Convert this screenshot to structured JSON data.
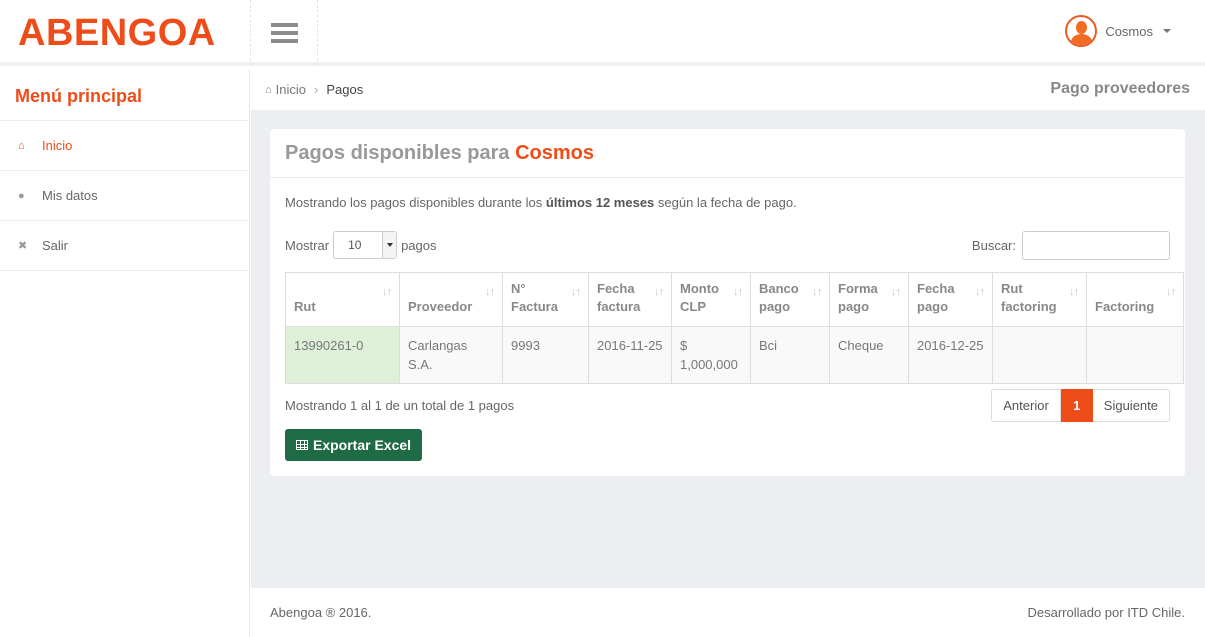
{
  "brand": {
    "logo": "ABENGOA"
  },
  "user": {
    "name": "Cosmos"
  },
  "sidebar": {
    "title": "Menú principal",
    "items": [
      {
        "label": "Inicio",
        "icon": "home-icon",
        "active": true
      },
      {
        "label": "Mis datos",
        "icon": "user-icon",
        "active": false
      },
      {
        "label": "Salir",
        "icon": "close-icon",
        "active": false
      }
    ]
  },
  "breadcrumb": {
    "home": "Inicio",
    "current": "Pagos"
  },
  "page_heading": "Pago proveedores",
  "panel": {
    "title_prefix": "Pagos disponibles para",
    "title_highlight": "Cosmos",
    "desc_before": "Mostrando los pagos disponibles durante los ",
    "desc_bold": "últimos 12 meses",
    "desc_after": " según la fecha de pago."
  },
  "length_control": {
    "label_before": "Mostrar",
    "value": "10",
    "label_after": "pagos"
  },
  "search": {
    "label": "Buscar:",
    "value": "",
    "placeholder": ""
  },
  "table": {
    "columns": [
      "Rut",
      "Proveedor",
      "N° Factura",
      "Fecha factura",
      "Monto CLP",
      "Banco pago",
      "Forma pago",
      "Fecha pago",
      "Rut factoring",
      "Factoring"
    ],
    "rows": [
      [
        "13990261-0",
        "Carlangas S.A.",
        "9993",
        "2016-11-25",
        "$ 1,000,000",
        "Bci",
        "Cheque",
        "2016-12-25",
        "",
        ""
      ]
    ]
  },
  "table_info": "Mostrando 1 al 1 de un total de 1 pagos",
  "pagination": {
    "prev": "Anterior",
    "current": "1",
    "next": "Siguiente"
  },
  "export_button": "Exportar Excel",
  "footer": {
    "left": "Abengoa ® 2016.",
    "right": "Desarrollado por ITD Chile."
  },
  "colors": {
    "accent": "#ee4d1a",
    "export_green": "#1e6b46",
    "sorted_cell": "#dff0d8"
  }
}
